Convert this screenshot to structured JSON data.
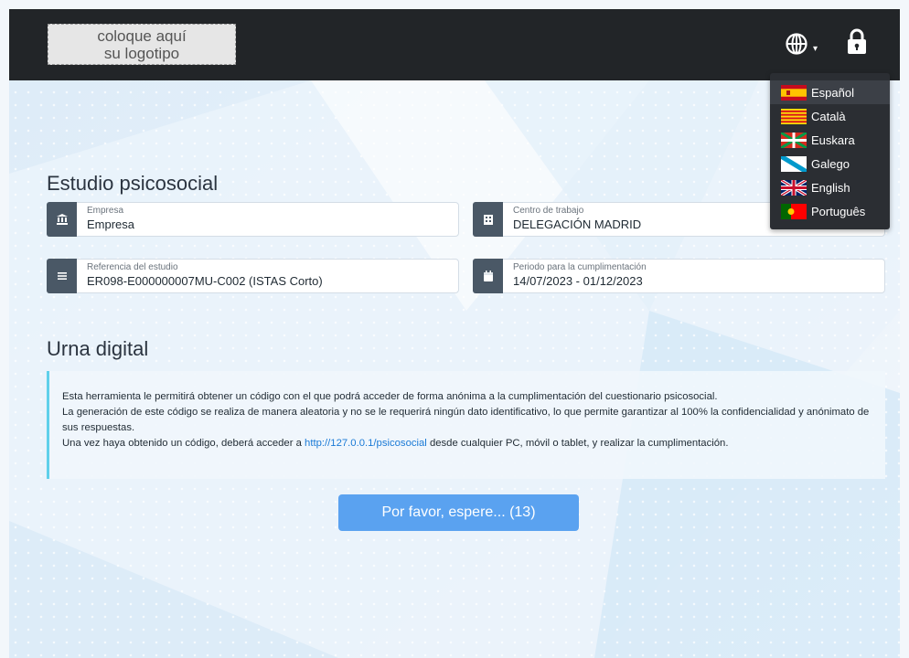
{
  "header": {
    "logo_line1": "coloque aquí",
    "logo_line2": "su logotipo"
  },
  "language_menu": {
    "items": [
      {
        "label": "Español",
        "flag": "es-flag-icon",
        "active": true
      },
      {
        "label": "Català",
        "flag": "ca-flag-icon",
        "active": false
      },
      {
        "label": "Euskara",
        "flag": "eu-flag-icon",
        "active": false
      },
      {
        "label": "Galego",
        "flag": "gl-flag-icon",
        "active": false
      },
      {
        "label": "English",
        "flag": "uk-flag-icon",
        "active": false
      },
      {
        "label": "Português",
        "flag": "pt-flag-icon",
        "active": false
      }
    ]
  },
  "study": {
    "title": "Estudio psicosocial",
    "company_label": "Empresa",
    "company_value": "Empresa",
    "workplace_label": "Centro de trabajo",
    "workplace_value": "DELEGACIÓN MADRID",
    "reference_label": "Referencia del estudio",
    "reference_value": "ER098-E000000007MU-C002 (ISTAS Corto)",
    "period_label": "Periodo para la cumplimentación",
    "period_value": "14/07/2023 - 01/12/2023"
  },
  "urn": {
    "title": "Urna digital",
    "paragraph1": "Esta herramienta le permitirá obtener un código con el que podrá acceder de forma anónima a la cumplimentación del cuestionario psicosocial.",
    "paragraph2": "La generación de este código se realiza de manera aleatoria y no se le requerirá ningún dato identificativo, lo que permite garantizar al 100% la confidencialidad y anónimato de sus respuestas.",
    "paragraph3_before": "Una vez haya obtenido un código, deberá acceder a ",
    "paragraph3_link": "http://127.0.0.1/psicosocial",
    "paragraph3_after": " desde cualquier PC, móvil o tablet, y realizar la cumplimentación.",
    "button_label": "Por favor, espere... (13)"
  },
  "colors": {
    "header_bg": "#222528",
    "accent": "#5aa2f0",
    "card_icon_bg": "#4a5866",
    "notice_border": "#5fd0ea"
  }
}
